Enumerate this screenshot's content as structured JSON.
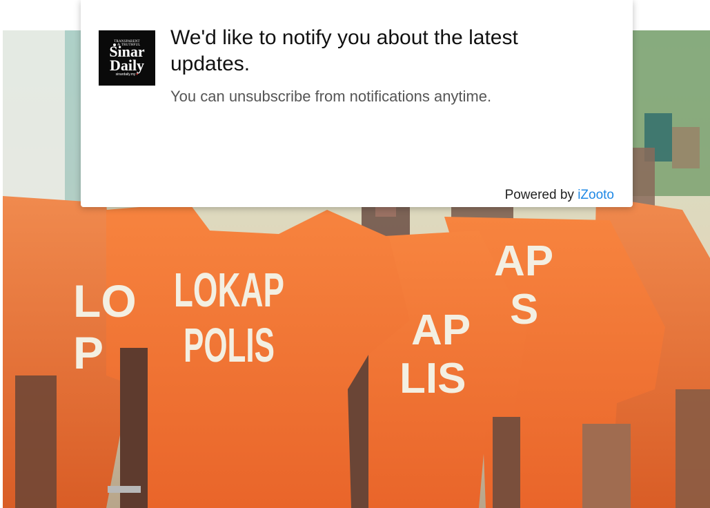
{
  "notification_prompt": {
    "logo": {
      "tagline_line1": "TRANSPARENT",
      "tagline_line2": "& TRUTHFUL",
      "name_line1": "Sinar",
      "name_line2": "Daily",
      "url": "sinardaily.my"
    },
    "title": "We'd like to notify you about the latest updates.",
    "subtitle": "You can unsubscribe from notifications anytime.",
    "powered_by_label": "Powered by",
    "powered_by_link": "iZooto",
    "link_color": "#1e88e5"
  },
  "background_photo": {
    "shirt_color": "#f47a3a",
    "shirt_text_line1": "LOKAP",
    "shirt_text_line2": "POLIS",
    "shirt_text_partial_left_1": "LO",
    "shirt_text_partial_left_2": "P",
    "shirt_text_partial_center_1": "AP",
    "shirt_text_partial_center_2": "LIS",
    "shirt_text_partial_right_1": "AP",
    "shirt_text_partial_right_2": "S"
  }
}
